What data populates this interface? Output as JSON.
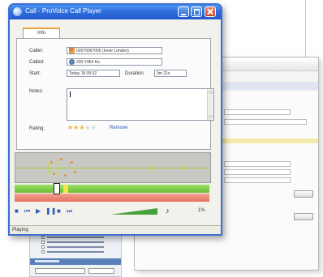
{
  "window": {
    "title": "Call - ProVoice Call Player",
    "tab_info": "Info"
  },
  "form": {
    "caller_label": "Caller:",
    "caller_value": "02070067000 (Inner London)",
    "called_label": "Called:",
    "called_value": "200 Y464 Ka",
    "start_label": "Start:",
    "start_value": "Today 16:35:32",
    "duration_label": "Duration:",
    "duration_value": "3m 21s",
    "notes_label": "Notes:",
    "rating_label": "Rating:",
    "rating_value": 3,
    "rating_max": 5,
    "remove_link": "Remove"
  },
  "player": {
    "volume_percent": "1%",
    "controls": [
      "stop",
      "previous",
      "play",
      "pause",
      "record",
      "next"
    ]
  },
  "status": {
    "text": "Playing"
  },
  "icons": {
    "caller": "phone-icon",
    "called": "network-icon",
    "volume": "speaker-icon"
  },
  "colors": {
    "title_bar": "#2f6fe0",
    "timeline_green": "#6bbf33",
    "timeline_red": "#e6725e",
    "volume": "#46a13a",
    "rating_star": "#f2b53a"
  }
}
